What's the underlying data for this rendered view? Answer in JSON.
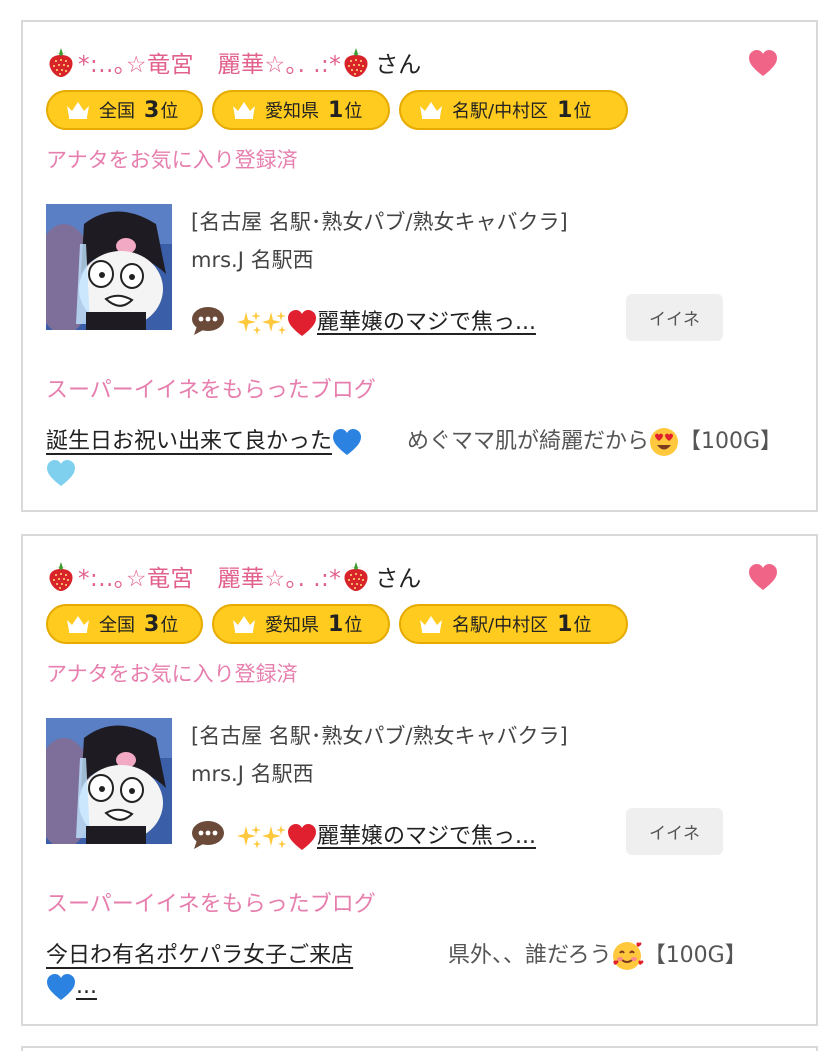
{
  "cards": [
    {
      "user_name": "*:..｡☆竜宮　麗華☆｡. .:*",
      "suffix": "さん",
      "ranks": [
        {
          "label": "全国",
          "num": "3",
          "suffix": "位"
        },
        {
          "label": "愛知県",
          "num": "1",
          "suffix": "位"
        },
        {
          "label": "名駅/中村区",
          "num": "1",
          "suffix": "位"
        }
      ],
      "favorite_status": "アナタをお気に入り登録済",
      "shop_category": "[名古屋 名駅･熟女パブ/熟女キャバクラ]",
      "store_name": "mrs.J 名駅西",
      "blog_title": "麗華嬢のマジで焦っ...",
      "like_label": "イイネ",
      "super_like_heading": "スーパーイイネをもらったブログ",
      "super_blog_link": "誕生日お祝い出来て良かった",
      "super_comment": "めぐママ肌が綺麗だから",
      "super_comment_tail": "【100G】"
    },
    {
      "user_name": "*:..｡☆竜宮　麗華☆｡. .:*",
      "suffix": "さん",
      "ranks": [
        {
          "label": "全国",
          "num": "3",
          "suffix": "位"
        },
        {
          "label": "愛知県",
          "num": "1",
          "suffix": "位"
        },
        {
          "label": "名駅/中村区",
          "num": "1",
          "suffix": "位"
        }
      ],
      "favorite_status": "アナタをお気に入り登録済",
      "shop_category": "[名古屋 名駅･熟女パブ/熟女キャバクラ]",
      "store_name": "mrs.J 名駅西",
      "blog_title": "麗華嬢のマジで焦っ...",
      "like_label": "イイネ",
      "super_like_heading": "スーパーイイネをもらったブログ",
      "super_blog_link": "今日わ有名ポケパラ女子ご来店",
      "super_blog_link_tail": "...",
      "super_comment": "県外、、誰だろう",
      "super_comment_tail": "【100G】"
    }
  ],
  "colors": {
    "pink_text": "#e2608c",
    "light_pink_text": "#e77fae",
    "rank_badge": "#ffcb1f",
    "heart": "#f06488",
    "border": "#d9d9d9"
  },
  "icons": [
    "strawberry-icon",
    "heart-icon",
    "crown-icon",
    "speech-bubble-icon",
    "sparkles-icon",
    "red-heart-icon",
    "blue-heart-icon",
    "light-blue-heart-icon",
    "heart-eyes-emoji",
    "smiling-hearts-emoji"
  ]
}
